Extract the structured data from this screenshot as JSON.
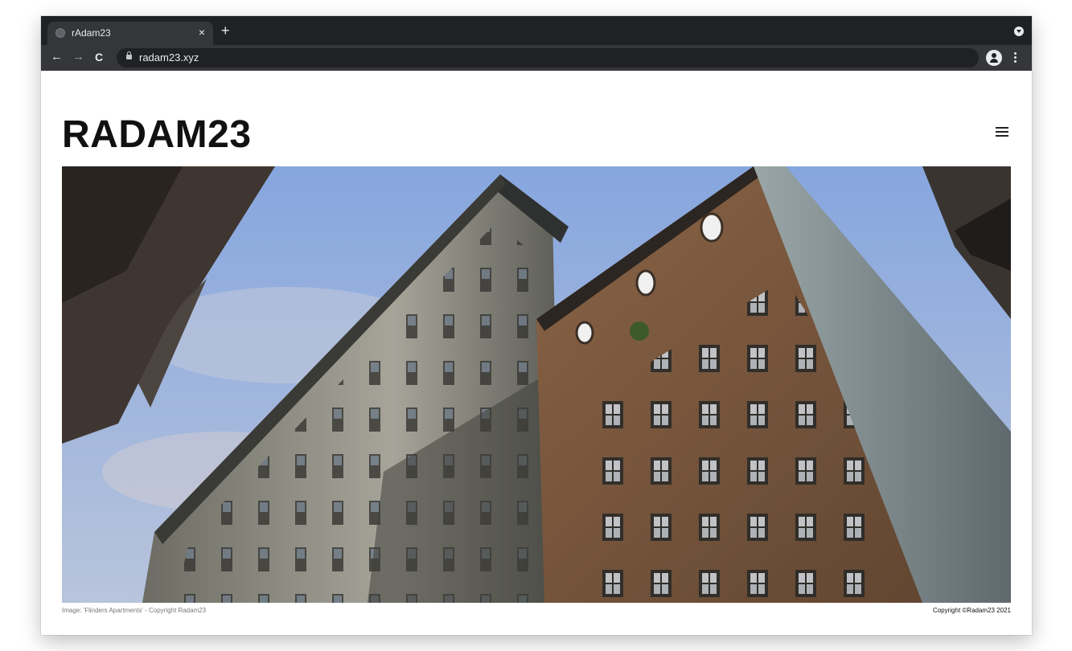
{
  "browser": {
    "tab_title": "rAdam23",
    "tab_close": "×",
    "new_tab": "+",
    "back": "←",
    "forward": "→",
    "reload": "C",
    "url": "radam23.xyz"
  },
  "site": {
    "title": "RADAM23",
    "image_caption": "Image: 'Flinders Apartments' - Copyright Radam23",
    "copyright": "Copyright ©Radam23 2021"
  },
  "colors": {
    "tabbar_bg": "#202124",
    "toolbar_bg": "#35363a",
    "title_text": "#111111",
    "sky": "#7f9fd6",
    "brick": "#7d5a3e",
    "stone": "#8a8a80"
  },
  "icons": [
    "globe-icon",
    "close-icon",
    "plus-icon",
    "back-arrow-icon",
    "forward-arrow-icon",
    "reload-icon",
    "lock-icon",
    "profile-icon",
    "kebab-menu-icon",
    "hamburger-menu-icon"
  ]
}
